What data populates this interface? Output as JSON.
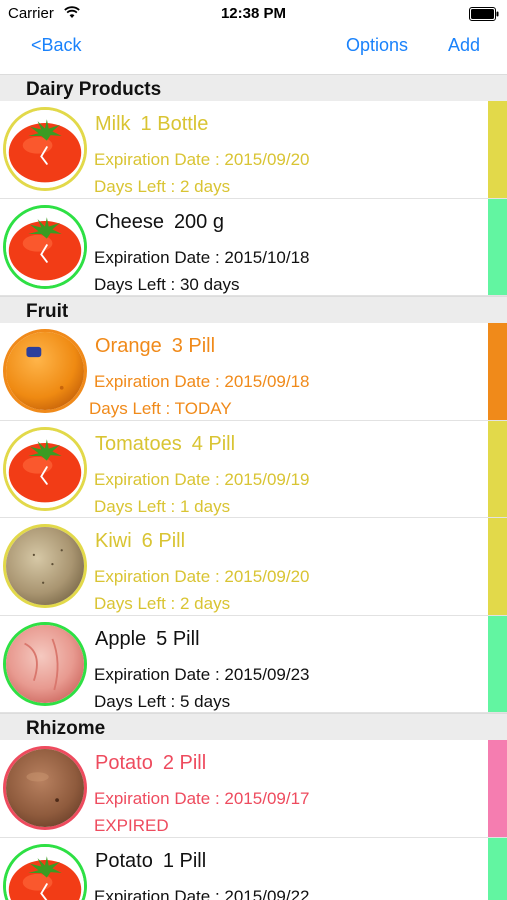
{
  "status": {
    "carrier": "Carrier",
    "time": "12:38 PM"
  },
  "nav": {
    "back": "<Back",
    "options": "Options",
    "add": "Add"
  },
  "colors": {
    "accent": "#1a82fb",
    "yellow_text": "#d9c433",
    "yellow_strip": "#e2d94a",
    "green_strip": "#62f5a1",
    "orange_text": "#f08a1a",
    "orange_strip": "#f08a1a",
    "red_text": "#ee4b5e",
    "pink_strip": "#f57db0",
    "normal_text": "#111111"
  },
  "sections": [
    {
      "title": "Dairy Products",
      "items": [
        {
          "name": "Milk",
          "qty": "1 Bottle",
          "expiration": "Expiration Date : 2015/09/20",
          "days": "Days Left : 2 days",
          "status": "yellow",
          "image": "tomato-icon"
        },
        {
          "name": "Cheese",
          "qty": "200 g",
          "expiration": "Expiration Date : 2015/10/18",
          "days": "Days Left : 30 days",
          "status": "green",
          "image": "tomato-icon"
        }
      ]
    },
    {
      "title": "Fruit",
      "items": [
        {
          "name": "Orange",
          "qty": "3 Pill",
          "expiration": "Expiration Date : 2015/09/18",
          "days": "Days Left : TODAY",
          "status": "orange",
          "image": "orange-photo"
        },
        {
          "name": "Tomatoes",
          "qty": "4 Pill",
          "expiration": "Expiration Date : 2015/09/19",
          "days": "Days Left : 1 days",
          "status": "yellow",
          "image": "tomato-icon"
        },
        {
          "name": "Kiwi",
          "qty": "6 Pill",
          "expiration": "Expiration Date : 2015/09/20",
          "days": "Days Left : 2 days",
          "status": "yellow",
          "image": "kiwi-photo"
        },
        {
          "name": "Apple",
          "qty": "5 Pill",
          "expiration": "Expiration Date : 2015/09/23",
          "days": "Days Left : 5 days",
          "status": "green",
          "image": "apple-photo"
        }
      ]
    },
    {
      "title": "Rhizome",
      "items": [
        {
          "name": "Potato",
          "qty": "2 Pill",
          "expiration": "Expiration Date : 2015/09/17",
          "days": "EXPIRED",
          "status": "red",
          "image": "potato-photo"
        },
        {
          "name": "Potato",
          "qty": "1 Pill",
          "expiration": "Expiration Date : 2015/09/22",
          "days": "",
          "status": "green",
          "image": "tomato-icon"
        }
      ]
    }
  ]
}
